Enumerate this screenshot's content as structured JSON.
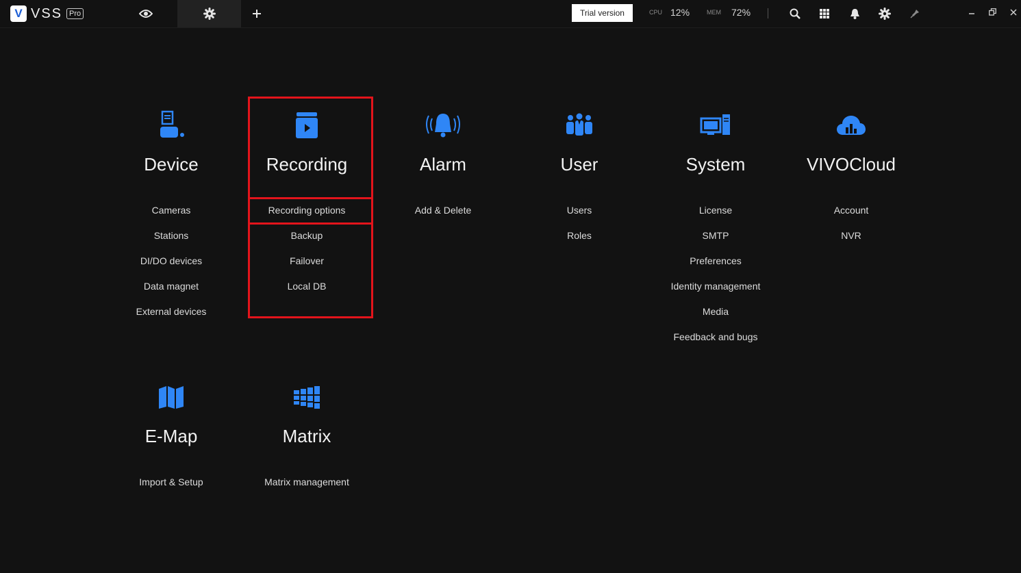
{
  "app": {
    "logo_letter": "V",
    "name": "VSS",
    "edition": "Pro"
  },
  "topbar": {
    "trial_label": "Trial version",
    "cpu_label": "CPU",
    "cpu_value": "12%",
    "mem_label": "MEM",
    "mem_value": "72%"
  },
  "icons": {
    "tabs": [
      "eye-icon",
      "gear-icon",
      "plus-icon"
    ],
    "toolbar": [
      "search-icon",
      "grid-icon",
      "bell-icon",
      "gear-icon",
      "pin-icon"
    ],
    "window": [
      "minimize-icon",
      "restore-icon",
      "close-icon"
    ]
  },
  "colors": {
    "accent": "#2f86f6",
    "highlight": "#e3141b",
    "background": "#121212"
  },
  "categories": [
    {
      "title": "Device",
      "icon": "device-icon",
      "items": [
        "Cameras",
        "Stations",
        "DI/DO devices",
        "Data magnet",
        "External devices"
      ]
    },
    {
      "title": "Recording",
      "icon": "recording-icon",
      "items": [
        "Recording options",
        "Backup",
        "Failover",
        "Local DB"
      ]
    },
    {
      "title": "Alarm",
      "icon": "alarm-bell-icon",
      "items": [
        "Add & Delete"
      ]
    },
    {
      "title": "User",
      "icon": "users-icon",
      "items": [
        "Users",
        "Roles"
      ]
    },
    {
      "title": "System",
      "icon": "computer-icon",
      "items": [
        "License",
        "SMTP",
        "Preferences",
        "Identity management",
        "Media",
        "Feedback and bugs"
      ]
    },
    {
      "title": "VIVOCloud",
      "icon": "cloud-icon",
      "items": [
        "Account",
        "NVR"
      ]
    },
    {
      "title": "E-Map",
      "icon": "map-icon",
      "items": [
        "Import & Setup"
      ]
    },
    {
      "title": "Matrix",
      "icon": "matrix-icon",
      "items": [
        "Matrix management"
      ]
    }
  ]
}
